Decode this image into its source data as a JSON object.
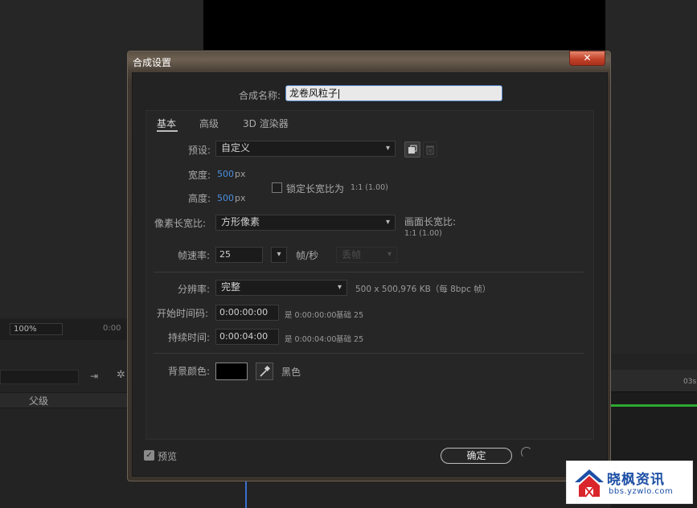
{
  "background": {
    "zoom_value": "100%",
    "timecode_partial": "0:00",
    "parent_column": "父级",
    "ruler_03s": "03s",
    "fx_icon": "✲"
  },
  "dialog": {
    "title": "合成设置",
    "close_label": "✕",
    "name_label": "合成名称:",
    "name_value": "龙卷风粒子",
    "tabs": [
      "基本",
      "高级",
      "3D 渲染器"
    ],
    "preset_label": "预设:",
    "preset_value": "自定义",
    "width_label": "宽度:",
    "width_value": "500",
    "width_unit": "px",
    "height_label": "高度:",
    "height_value": "500",
    "height_unit": "px",
    "lock_aspect_label": "锁定长宽比为",
    "lock_aspect_ratio": "1:1 (1.00)",
    "par_label": "像素长宽比:",
    "par_value": "方形像素",
    "frame_aspect_label": "画面长宽比:",
    "frame_aspect_value": "1:1 (1.00)",
    "fps_label": "帧速率:",
    "fps_value": "25",
    "fps_unit": "帧/秒",
    "drop_frame_value": "丢帧",
    "resolution_label": "分辨率:",
    "resolution_value": "完整",
    "resolution_info": "500 x 500,976 KB（每 8bpc 帧）",
    "start_tc_label": "开始时间码:",
    "start_tc_value": "0:00:00:00",
    "start_tc_info": "是 0:00:00:00",
    "start_tc_base": "基础 25",
    "duration_label": "持续时间:",
    "duration_value": "0:00:04:00",
    "duration_info": "是 0:00:04:00",
    "duration_base": "基础 25",
    "bg_color_label": "背景颜色:",
    "bg_color_name": "黑色",
    "preview_label": "预览",
    "ok_label": "确定"
  },
  "watermark": {
    "title": "晓枫资讯",
    "url": "bbs.yzwlo.com"
  },
  "colors": {
    "accent_blue": "#4a8fe0",
    "bg_color_swatch": "#000000",
    "close_red": "#c3432a"
  }
}
